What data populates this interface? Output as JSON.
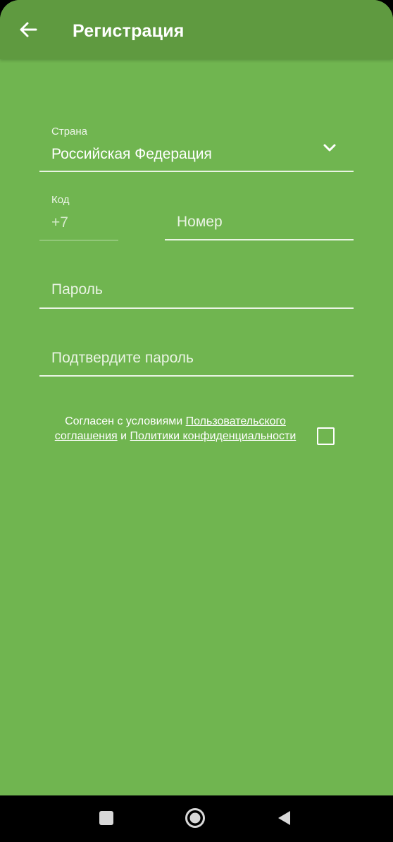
{
  "app_bar": {
    "title": "Регистрация",
    "back_icon": "arrow-left-icon"
  },
  "form": {
    "country": {
      "label": "Страна",
      "value": "Российская Федерация",
      "icon": "chevron-down-icon"
    },
    "code": {
      "label": "Код",
      "value": "+7"
    },
    "number": {
      "placeholder": "Номер"
    },
    "password": {
      "placeholder": "Пароль"
    },
    "confirm_password": {
      "placeholder": "Подтвердите пароль"
    }
  },
  "agreement": {
    "text_prefix": "Согласен с условиями ",
    "link_user_agreement": "Пользовательского соглашения",
    "text_and": " и ",
    "link_privacy": "Политики конфиденциальности",
    "checked": false
  },
  "system_nav": {
    "recents_icon": "square-icon",
    "home_icon": "circle-icon",
    "back_icon": "triangle-back-icon"
  },
  "colors": {
    "background": "#70b550",
    "app_bar": "#5f9a40",
    "text": "#ffffff",
    "nav_bar": "#000000"
  }
}
